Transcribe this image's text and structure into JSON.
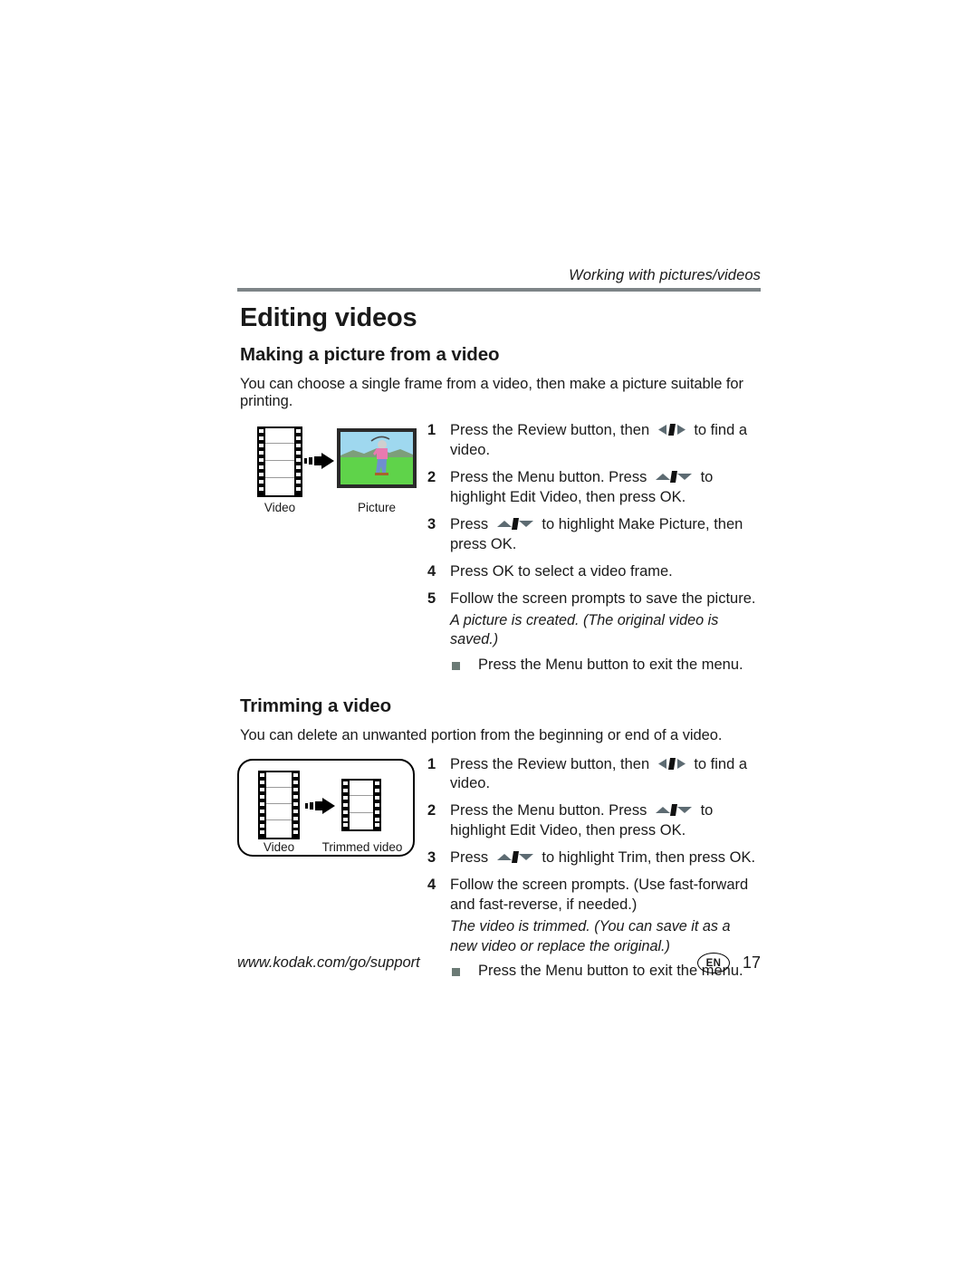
{
  "header": {
    "running_head": "Working with pictures/videos"
  },
  "chapter_title": "Editing videos",
  "sections": [
    {
      "heading": "Making a picture from a video",
      "intro": "You can choose a single frame from a video, then make a picture suitable for printing.",
      "figure": {
        "left_caption": "Video",
        "right_caption": "Picture",
        "bordered": false
      },
      "steps": [
        {
          "num": "1",
          "before": "Press the Review button, then",
          "glyph": "left-right-arrows",
          "after": "to find a video."
        },
        {
          "num": "2",
          "before": "Press the Menu button. Press",
          "glyph": "up-down-arrows",
          "after": "to highlight Edit Video, then press OK."
        },
        {
          "num": "3",
          "before": "Press",
          "glyph": "up-down-arrows",
          "after": "to highlight Make Picture, then press OK."
        },
        {
          "num": "4",
          "before": "Press OK to select a video frame.",
          "glyph": "",
          "after": ""
        },
        {
          "num": "5",
          "before": "Follow the screen prompts to save the picture.",
          "glyph": "",
          "after": ""
        }
      ],
      "note": "A picture is created. (The original video is saved.)",
      "bullets": [
        "Press the Menu button to exit the menu."
      ]
    },
    {
      "heading": "Trimming a video",
      "intro": "You can delete an unwanted portion from the beginning or end of a video.",
      "figure": {
        "left_caption": "Video",
        "right_caption": "Trimmed video",
        "bordered": true
      },
      "steps": [
        {
          "num": "1",
          "before": "Press the Review button, then",
          "glyph": "left-right-arrows",
          "after": "to find a video."
        },
        {
          "num": "2",
          "before": "Press the Menu button. Press",
          "glyph": "up-down-arrows",
          "after": "to highlight Edit Video, then press OK."
        },
        {
          "num": "3",
          "before": "Press",
          "glyph": "up-down-arrows",
          "after": "to highlight Trim, then press OK."
        },
        {
          "num": "4",
          "before": "Follow the screen prompts. (Use fast-forward and fast-reverse, if needed.)",
          "glyph": "",
          "after": ""
        }
      ],
      "note": "The video is trimmed. (You can save it as a new video or replace the original.)",
      "bullets": [
        "Press the Menu button to exit the menu."
      ]
    }
  ],
  "footer": {
    "url": "www.kodak.com/go/support",
    "language_badge": "EN",
    "page_number": "17"
  },
  "colors": {
    "rule": "#7d8487",
    "arrow_gray": "#5d6b72",
    "bullet_square": "#6b7a75",
    "sky": "#9fd8ef",
    "grass": "#5fd34a",
    "hills": "#7d9e7a",
    "shirt": "#e87ab0",
    "jeans": "#6f8fd0",
    "text": "#1a1a1a"
  }
}
